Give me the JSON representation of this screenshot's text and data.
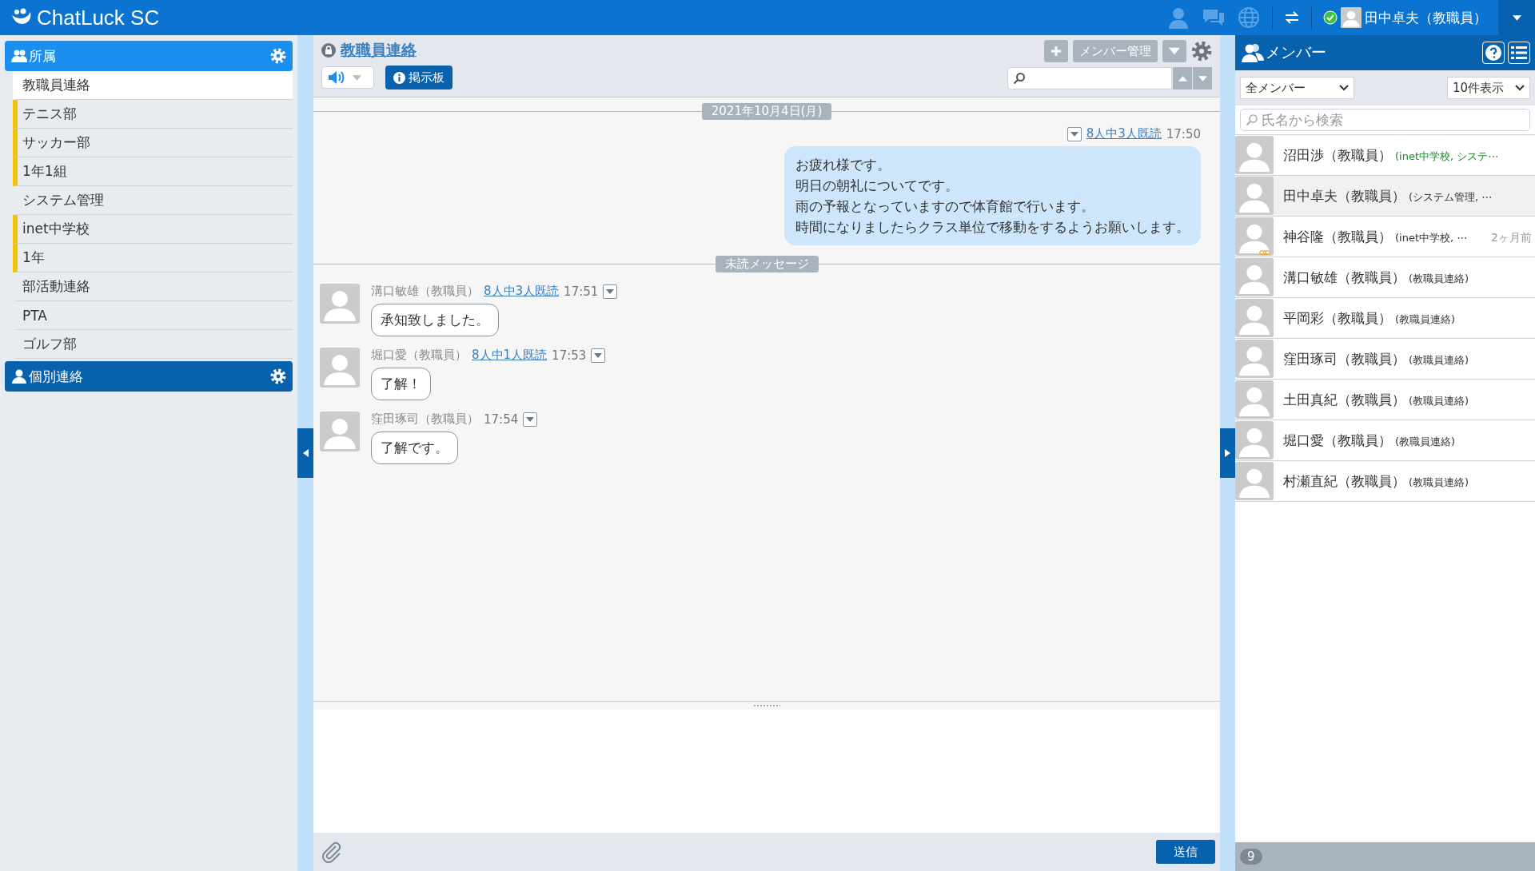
{
  "topbar": {
    "logo": "ChatLuck SC",
    "user": "田中卓夫（教職員）",
    "online": true
  },
  "sidebar": {
    "groups": [
      {
        "title": "所属",
        "kind": "group",
        "expanded": true,
        "items": [
          {
            "label": "教職員連絡",
            "selected": true,
            "unread": false
          },
          {
            "label": "テニス部",
            "selected": false,
            "unread": true
          },
          {
            "label": "サッカー部",
            "selected": false,
            "unread": true
          },
          {
            "label": "1年1組",
            "selected": false,
            "unread": true
          },
          {
            "label": "システム管理",
            "selected": false,
            "unread": false
          },
          {
            "label": "inet中学校",
            "selected": false,
            "unread": true
          },
          {
            "label": "1年",
            "selected": false,
            "unread": true
          },
          {
            "label": "部活動連絡",
            "selected": false,
            "unread": false
          },
          {
            "label": "PTA",
            "selected": false,
            "unread": false
          },
          {
            "label": "ゴルフ部",
            "selected": false,
            "unread": false
          }
        ]
      },
      {
        "title": "個別連絡",
        "kind": "person",
        "expanded": false
      }
    ]
  },
  "chat": {
    "title": "教職員連絡",
    "sound_on": true,
    "board_button": "掲示板",
    "member_button": "メンバー管理",
    "date": "2021年10月4日(月)",
    "unread_divider": "未読メッセージ",
    "messages": [
      {
        "kind": "own",
        "read": "8人中3人既読",
        "time": "17:50",
        "lines": [
          "お疲れ様です。",
          "明日の朝礼についてです。",
          "雨の予報となっていますので体育館で行います。",
          "時間になりましたらクラス単位で移動をするようお願いします。"
        ]
      },
      {
        "kind": "other",
        "sender": "溝口敏雄（教職員）",
        "read": "8人中3人既読",
        "time": "17:51",
        "text": "承知致しました。"
      },
      {
        "kind": "other",
        "sender": "堀口愛（教職員）",
        "read": "8人中1人既読",
        "time": "17:53",
        "text": "了解！"
      },
      {
        "kind": "other",
        "sender": "窪田琢司（教職員）",
        "time": "17:54",
        "text": "了解です。"
      }
    ],
    "send_button": "送信"
  },
  "members": {
    "title": "メンバー",
    "filter": "全メンバー",
    "page_size": "10件表示",
    "search_placeholder": "氏名から検索",
    "count": "9",
    "items": [
      {
        "name": "沼田渉（教職員）",
        "groups": "(inet中学校, システ⋯",
        "online": true,
        "selected": false
      },
      {
        "name": "田中卓夫（教職員）",
        "groups": "(システム管理, ⋯",
        "online": false,
        "selected": true
      },
      {
        "name": "神谷隆（教職員）",
        "groups": "(inet中学校, ⋯",
        "last_seen": "2ヶ月前",
        "linked": true,
        "online": false,
        "selected": false
      },
      {
        "name": "溝口敏雄（教職員）",
        "groups": "(教職員連絡)",
        "online": false,
        "selected": false
      },
      {
        "name": "平岡彩（教職員）",
        "groups": "(教職員連絡)",
        "online": false,
        "selected": false
      },
      {
        "name": "窪田琢司（教職員）",
        "groups": "(教職員連絡)",
        "online": false,
        "selected": false
      },
      {
        "name": "土田真紀（教職員）",
        "groups": "(教職員連絡)",
        "online": false,
        "selected": false
      },
      {
        "name": "堀口愛（教職員）",
        "groups": "(教職員連絡)",
        "online": false,
        "selected": false
      },
      {
        "name": "村瀬直紀（教職員）",
        "groups": "(教職員連絡)",
        "online": false,
        "selected": false
      }
    ]
  }
}
